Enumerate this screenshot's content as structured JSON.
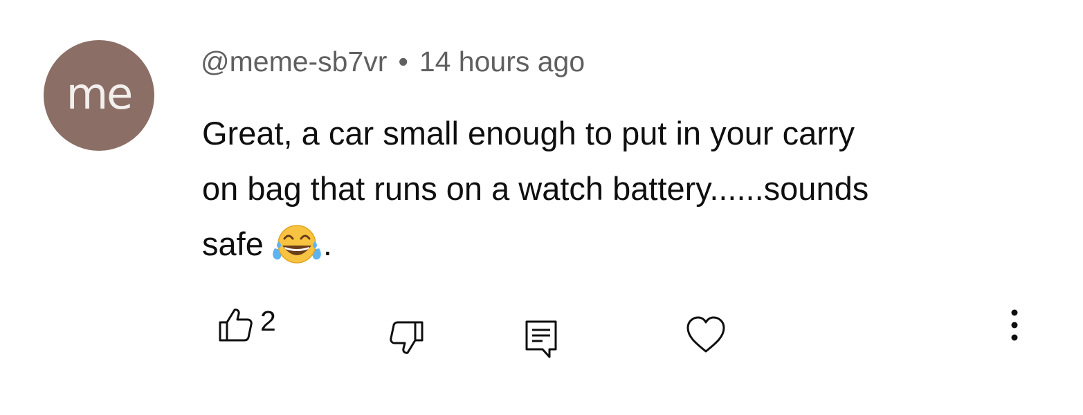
{
  "comment": {
    "avatar_initials": "me",
    "avatar_color": "#8b6f66",
    "handle": "@meme-sb7vr",
    "separator": "•",
    "timestamp": "14 hours ago",
    "text_line1": "Great, a car small enough to put in your carry",
    "text_line2": "on bag that runs on a watch battery......sounds",
    "text_line3_before_emoji": "safe",
    "text_emoji_name": "face-with-tears-of-joy",
    "text_line3_after_emoji": "."
  },
  "actions": {
    "like_icon": "thumbs-up-icon",
    "like_count": "2",
    "dislike_icon": "thumbs-down-icon",
    "reply_icon": "reply-icon",
    "heart_icon": "heart-icon",
    "more_icon": "more-vertical-icon"
  }
}
